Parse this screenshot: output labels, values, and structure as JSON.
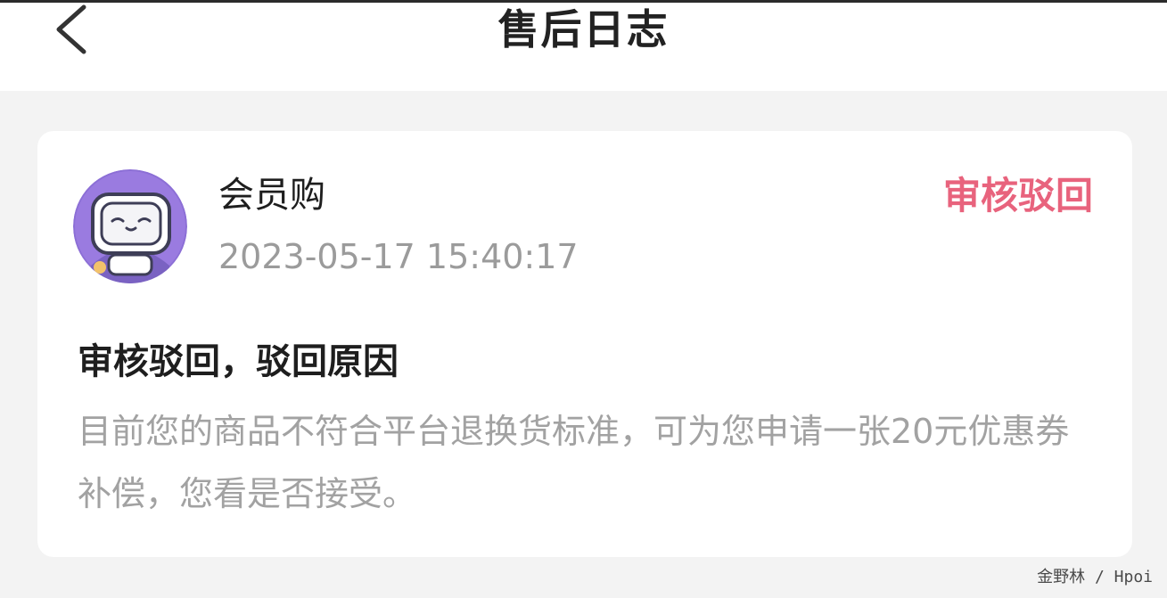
{
  "header": {
    "back_icon": "chevron-left-icon",
    "title": "售后日志"
  },
  "log": {
    "avatar_icon": "robot-mascot-avatar",
    "shop_name": "会员购",
    "timestamp": "2023-05-17 15:40:17",
    "status": "审核驳回",
    "status_color": "#e8637d",
    "title": "审核驳回，驳回原因",
    "body": "目前您的商品不符合平台退换货标准，可为您申请一张20元优惠券补偿，您看是否接受。"
  },
  "watermark": "金野林 / Hpoi"
}
